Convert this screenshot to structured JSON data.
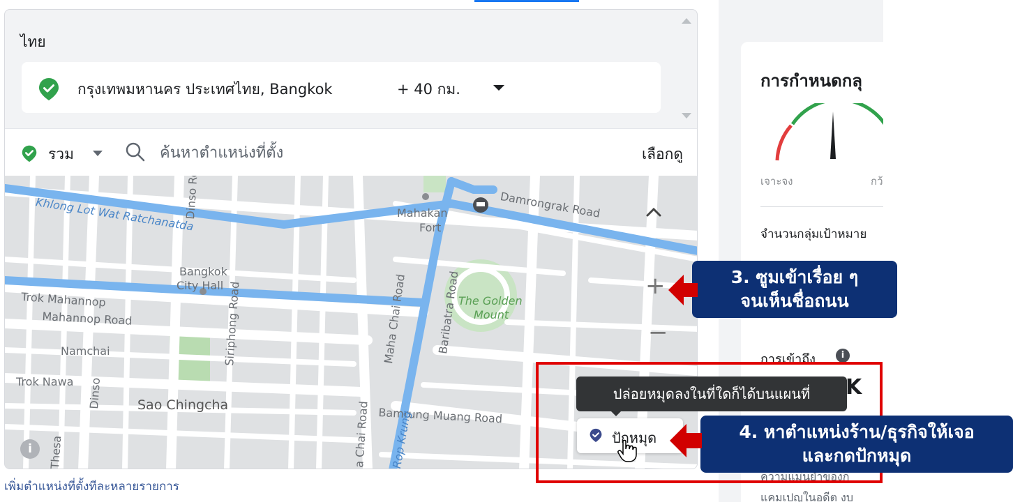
{
  "location_panel": {
    "country": "ไทย",
    "location_name": "กรุงเทพมหานคร ประเทศไทย, Bangkok",
    "radius": "+ 40 กม.",
    "include_label": "รวม",
    "search_placeholder": "ค้นหาตำแหน่งที่ตั้ง",
    "browse_label": "เลือกดู",
    "add_multiple_link": "เพิ่มตำแหน่งที่ตั้งทีละหลายรายการ"
  },
  "map": {
    "labels": {
      "khlong": "Khlong Lot Wat Ratchanatda",
      "mahakan": "Mahakan",
      "fort": "Fort",
      "damrongrak": "Damrongrak Road",
      "bangkok": "Bangkok",
      "city_hall": "City Hall",
      "trok_mahannop": "Trok Mahannop",
      "mahannop_road": "Mahannop Road",
      "namchai": "Namchai",
      "trok_nawa": "Trok Nawa",
      "sao_chingcha": "Sao Chingcha",
      "golden": "The Golden",
      "mount": "Mount",
      "maha_chai": "Maha Chai Road",
      "baribatra": "Baribatra Road",
      "bamrung": "Bamrung Muang Road",
      "siriphong": "Siriphong Road",
      "dinso": "Dinso Ro",
      "dinso2": "Dinso",
      "rop_krung": "Rop Krung",
      "chai_road": "a Chai Road",
      "thesa": "Thesa"
    },
    "zoom_in": "+",
    "zoom_out": "−",
    "info": "i",
    "tooltip": "ปล่อยหมุดลงในที่ใดก็ได้บนแผนที่",
    "drop_pin_label": "ปักหมุด"
  },
  "right_panel": {
    "title": "การกำหนดกลุ",
    "gauge_left": "เจาะจง",
    "gauge_right": "กว้",
    "audience_label": "จำนวนกลุ่มเป้าหมาย",
    "reach_label": "การเข้าถึง",
    "reach_info": "i",
    "reach_value": "K",
    "accuracy_text": "ความแม่นยำของก",
    "campaign_text": "แคมเปญในอดีต งบ"
  },
  "annotations": {
    "step3": [
      "3. ซูมเข้าเรื่อย ๆ",
      "จนเห็นชื่อถนน"
    ],
    "step4": [
      "4. หาตำแหน่งร้าน/ธุรกิจให้เจอ",
      "และกดปักหมุด"
    ]
  },
  "colors": {
    "accent_blue": "#1877f2",
    "pin_green": "#31a24c",
    "annotation_navy": "#0d3074",
    "annotation_red": "#e00000",
    "gauge_red": "#e23d3d",
    "gauge_green": "#31a24c"
  }
}
